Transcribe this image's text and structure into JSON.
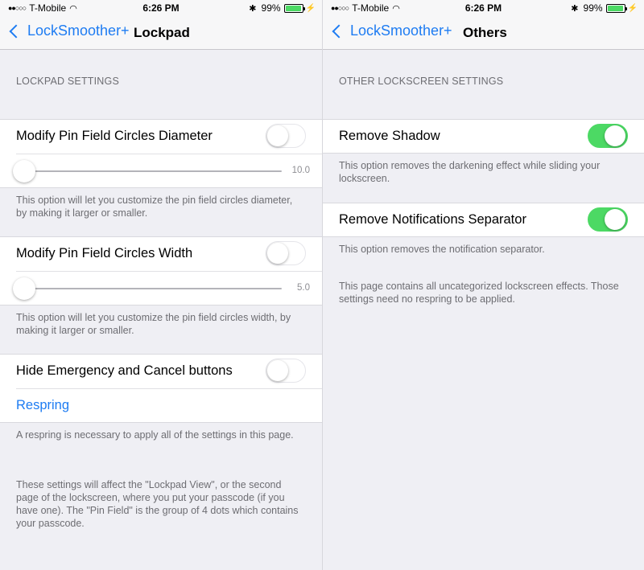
{
  "status": {
    "carrier": "T-Mobile",
    "time": "6:26 PM",
    "battery_percent": "99%",
    "battery_level": 0.99,
    "accent_color": "#1e7cf2",
    "toggle_on_color": "#4cd964"
  },
  "left": {
    "nav": {
      "back_label": "LockSmoother+",
      "title": "Lockpad"
    },
    "section_header": "LOCKPAD SETTINGS",
    "diameter": {
      "label": "Modify Pin Field Circles Diameter",
      "enabled": false,
      "slider_value": "10.0",
      "footer": "This option will let you customize the pin field circles diameter, by making it larger or smaller."
    },
    "width": {
      "label": "Modify Pin Field Circles Width",
      "enabled": false,
      "slider_value": "5.0",
      "footer": "This option will let you customize the pin field circles width, by making it larger or smaller."
    },
    "hide_buttons": {
      "label": "Hide Emergency and Cancel buttons",
      "enabled": false
    },
    "respring_label": "Respring",
    "respring_footer": "A respring is necessary to apply all of the settings in this page.",
    "info_footer": "These settings will affect the \"Lockpad View\", or the second page of the lockscreen, where you put your passcode (if you have one). The \"Pin Field\" is the group of 4 dots which contains your passcode."
  },
  "right": {
    "nav": {
      "back_label": "LockSmoother+",
      "title": "Others"
    },
    "section_header": "OTHER LOCKSCREEN SETTINGS",
    "remove_shadow": {
      "label": "Remove Shadow",
      "enabled": true,
      "footer": "This option removes the darkening effect while sliding your lockscreen."
    },
    "remove_separator": {
      "label": "Remove Notifications Separator",
      "enabled": true,
      "footer": "This option removes the notification separator."
    },
    "page_footer": "This page contains all uncategorized lockscreen effects. Those settings need no respring to be applied."
  }
}
